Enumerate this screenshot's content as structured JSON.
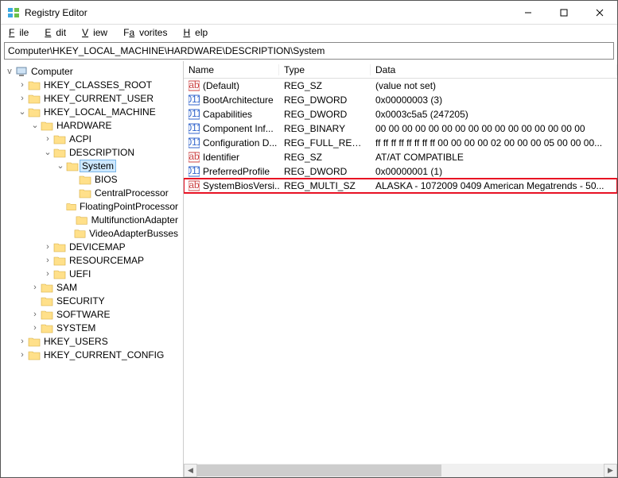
{
  "window": {
    "title": "Registry Editor"
  },
  "menu": {
    "file": "File",
    "edit": "Edit",
    "view": "View",
    "favorites": "Favorites",
    "help": "Help"
  },
  "address": "Computer\\HKEY_LOCAL_MACHINE\\HARDWARE\\DESCRIPTION\\System",
  "columns": {
    "name": "Name",
    "type": "Type",
    "data": "Data"
  },
  "tree": {
    "root": "Computer",
    "nodes": [
      {
        "label": "HKEY_CLASSES_ROOT",
        "depth": 1,
        "toggle": ">"
      },
      {
        "label": "HKEY_CURRENT_USER",
        "depth": 1,
        "toggle": ">"
      },
      {
        "label": "HKEY_LOCAL_MACHINE",
        "depth": 1,
        "toggle": "v"
      },
      {
        "label": "HARDWARE",
        "depth": 2,
        "toggle": "v"
      },
      {
        "label": "ACPI",
        "depth": 3,
        "toggle": ">"
      },
      {
        "label": "DESCRIPTION",
        "depth": 3,
        "toggle": "v"
      },
      {
        "label": "System",
        "depth": 4,
        "toggle": "v",
        "selected": true
      },
      {
        "label": "BIOS",
        "depth": 5,
        "toggle": ""
      },
      {
        "label": "CentralProcessor",
        "depth": 5,
        "toggle": ""
      },
      {
        "label": "FloatingPointProcessor",
        "depth": 5,
        "toggle": ""
      },
      {
        "label": "MultifunctionAdapter",
        "depth": 5,
        "toggle": ""
      },
      {
        "label": "VideoAdapterBusses",
        "depth": 5,
        "toggle": ""
      },
      {
        "label": "DEVICEMAP",
        "depth": 3,
        "toggle": ">"
      },
      {
        "label": "RESOURCEMAP",
        "depth": 3,
        "toggle": ">"
      },
      {
        "label": "UEFI",
        "depth": 3,
        "toggle": ">"
      },
      {
        "label": "SAM",
        "depth": 2,
        "toggle": ">"
      },
      {
        "label": "SECURITY",
        "depth": 2,
        "toggle": ""
      },
      {
        "label": "SOFTWARE",
        "depth": 2,
        "toggle": ">"
      },
      {
        "label": "SYSTEM",
        "depth": 2,
        "toggle": ">"
      },
      {
        "label": "HKEY_USERS",
        "depth": 1,
        "toggle": ">"
      },
      {
        "label": "HKEY_CURRENT_CONFIG",
        "depth": 1,
        "toggle": ">"
      }
    ]
  },
  "values": [
    {
      "icon": "str",
      "name": "(Default)",
      "type": "REG_SZ",
      "data": "(value not set)"
    },
    {
      "icon": "bin",
      "name": "BootArchitecture",
      "type": "REG_DWORD",
      "data": "0x00000003 (3)"
    },
    {
      "icon": "bin",
      "name": "Capabilities",
      "type": "REG_DWORD",
      "data": "0x0003c5a5 (247205)"
    },
    {
      "icon": "bin",
      "name": "Component Inf...",
      "type": "REG_BINARY",
      "data": "00 00 00 00 00 00 00 00 00 00 00 00 00 00 00 00"
    },
    {
      "icon": "bin",
      "name": "Configuration D...",
      "type": "REG_FULL_RESOU...",
      "data": "ff ff ff ff ff ff ff ff 00 00 00 00 02 00 00 00 05 00 00 00..."
    },
    {
      "icon": "str",
      "name": "Identifier",
      "type": "REG_SZ",
      "data": "AT/AT COMPATIBLE"
    },
    {
      "icon": "bin",
      "name": "PreferredProfile",
      "type": "REG_DWORD",
      "data": "0x00000001 (1)"
    },
    {
      "icon": "str",
      "name": "SystemBiosVersi...",
      "type": "REG_MULTI_SZ",
      "data": "ALASKA - 1072009 0409 American Megatrends - 50...",
      "highlight": true
    }
  ]
}
